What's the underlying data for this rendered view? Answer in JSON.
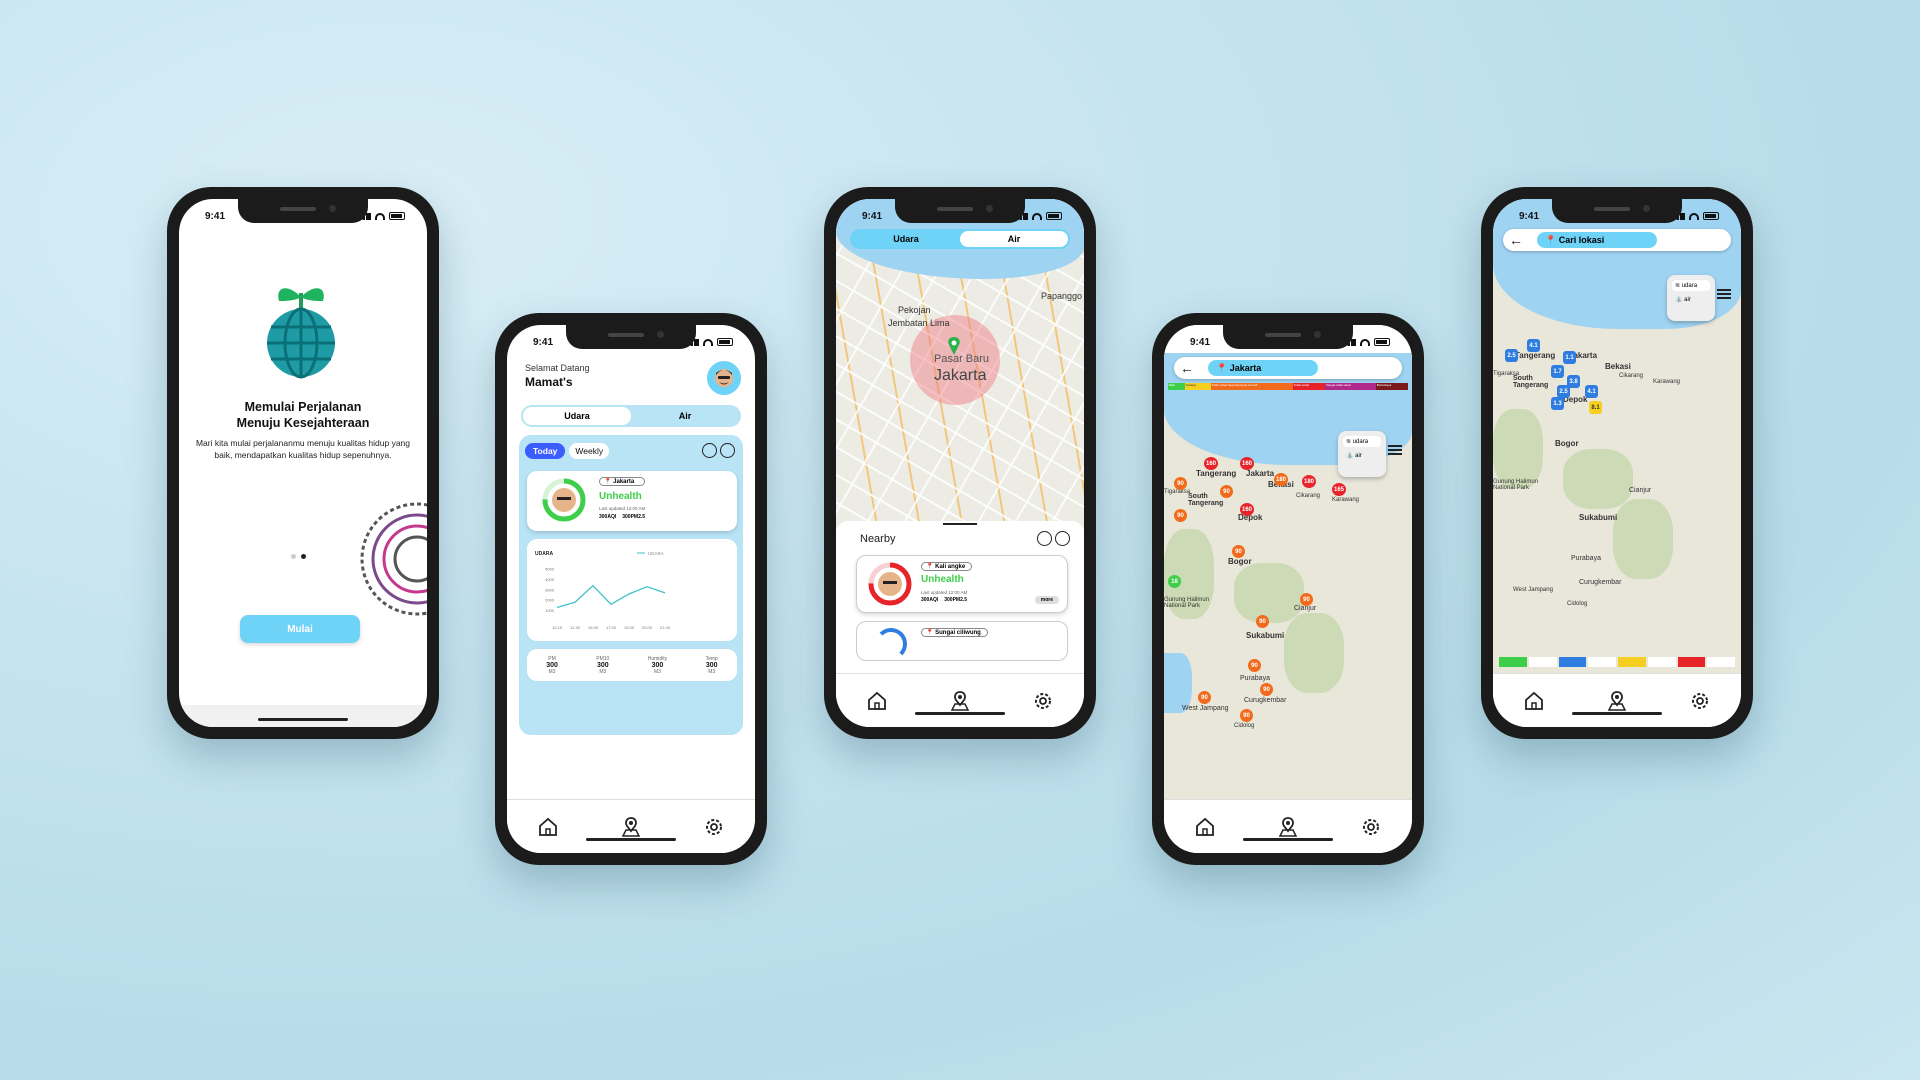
{
  "status_time": "9:41",
  "colors": {
    "accent": "#6fd3f7",
    "light_panel": "#b8e4f6",
    "unhealthy_green": "#3ecf4a",
    "unhealthy_red": "#e8242b",
    "today_blue": "#3b5cff",
    "pin_red": "#e8242b",
    "pin_orange": "#f26a1b",
    "pin_blue": "#2f7de0"
  },
  "onboarding": {
    "title_line1": "Memulai Perjalanan",
    "title_line2": "Menuju Kesejahteraan",
    "description": "Mari kita mulai perjalananmu menuju kualitas hidup yang baik, mendapatkan kualitas hidup sepenuhnya.",
    "button_label": "Mulai"
  },
  "home": {
    "greeting": "Selamat Datang",
    "username": "Mamat's",
    "segment_udara": "Udara",
    "segment_air": "Air",
    "tab_today": "Today",
    "tab_weekly": "Weekly",
    "card_location": "Jakarta",
    "card_status": "Unhealth",
    "card_updated": "Last updated 12:00 AM",
    "card_aqi": "300AQI",
    "card_pm": "300PM2.5",
    "chart_title": "UDARA",
    "chart_legend": "UDARA",
    "stats": [
      {
        "label": "PM",
        "value": "300",
        "unit": "M3"
      },
      {
        "label": "PM10",
        "value": "300",
        "unit": "M3"
      },
      {
        "label": "Humidity",
        "value": "300",
        "unit": "M3"
      },
      {
        "label": "Temp",
        "value": "300",
        "unit": "M3"
      }
    ]
  },
  "chart_data": {
    "type": "line",
    "title": "UDARA",
    "x": [
      "10.15",
      "12.30",
      "15.00",
      "17.00",
      "19.00",
      "20.00",
      "21.00"
    ],
    "y_ticks": [
      "5000",
      "4000",
      "3000",
      "2000",
      "1000"
    ],
    "series": [
      {
        "name": "UDARA",
        "values": [
          1300,
          1800,
          3400,
          1600,
          2600,
          3300,
          2700
        ]
      }
    ],
    "ylim": [
      0,
      5000
    ]
  },
  "map_screen": {
    "segment_udara": "Udara",
    "segment_air": "Air",
    "labels": [
      "Pekojan",
      "Jembatan Lima",
      "Papanggo",
      "Pasar Baru"
    ],
    "city": "Jakarta",
    "nearby_title": "Nearby",
    "nearby_cards": [
      {
        "location": "Kali angke",
        "status": "Unhealth",
        "updated": "Last updated 12:00 AM",
        "aqi": "300AQI",
        "pm": "300PM2.5",
        "more": "more"
      },
      {
        "location": "Sungai ciliwung"
      }
    ]
  },
  "map2": {
    "search_value": "Jakarta",
    "legend": [
      "Baik",
      "Sedang",
      "Tidak sehat bagi kelompok sensitif",
      "Tidak sehat",
      "Sangat tidak sehat",
      "Berbahaya"
    ],
    "layer_udara": "udara",
    "layer_air": "air",
    "cities": [
      "Tangerang",
      "Jakarta",
      "Bekasi",
      "South Tangerang",
      "Depok",
      "Bogor",
      "Cianjur",
      "Sukabumi",
      "Purabaya",
      "Curugkembar",
      "West Jampang",
      "Cidolog",
      "Karawang",
      "Cikarang",
      "Tigaraksa",
      "Gunung Halimun National Park"
    ],
    "pins": [
      "160",
      "160",
      "180",
      "180",
      "165",
      "90",
      "90",
      "160",
      "90",
      "90",
      "90",
      "90",
      "90",
      "90",
      "90",
      "90",
      "18"
    ]
  },
  "map3": {
    "search_placeholder": "Cari lokasi",
    "layer_udara": "udara",
    "layer_air": "air",
    "cities": [
      "Tangerang",
      "Jakarta",
      "Bekasi",
      "South Tangerang",
      "Depok",
      "Bogor",
      "Cianjur",
      "Sukabumi",
      "Purabaya",
      "Curugkembar",
      "West Jampang",
      "Cidolog",
      "Karawang",
      "Cikarang",
      "Tigaraksa",
      "Gunung Halimun National Park"
    ],
    "pins": [
      "4.1",
      "2.5",
      "1.1",
      "1.7",
      "3.8",
      "2.5",
      "4.1",
      "1.3",
      "8.1"
    ]
  }
}
